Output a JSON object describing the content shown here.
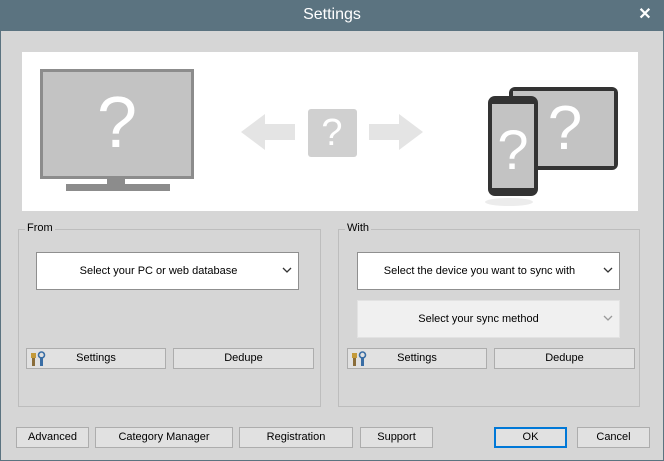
{
  "window": {
    "title": "Settings"
  },
  "from": {
    "label": "From",
    "source_select": "Select your PC or web database",
    "settings_label": "Settings",
    "dedupe_label": "Dedupe"
  },
  "with": {
    "label": "With",
    "device_select": "Select the device you want to sync with",
    "method_select": "Select your sync method",
    "settings_label": "Settings",
    "dedupe_label": "Dedupe"
  },
  "footer": {
    "advanced": "Advanced",
    "category_manager": "Category Manager",
    "registration": "Registration",
    "support": "Support",
    "ok": "OK",
    "cancel": "Cancel"
  },
  "banner": {
    "unknown_glyph": "?"
  },
  "colors": {
    "titlebar": "#5b7380",
    "dialog": "#d6d6d6",
    "accent": "#0078d7"
  }
}
